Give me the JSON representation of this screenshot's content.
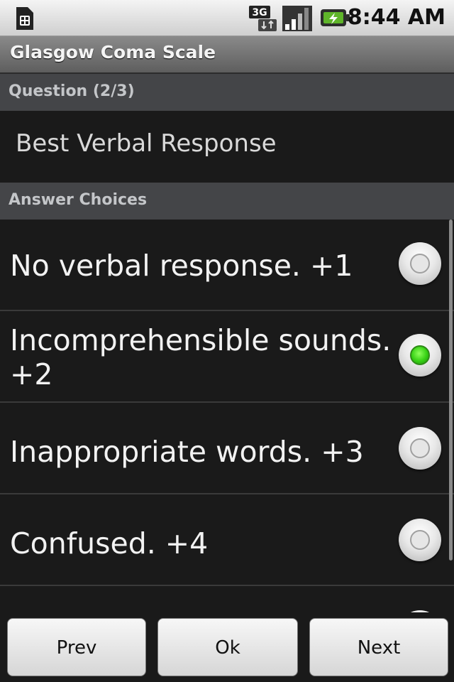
{
  "status_bar": {
    "time": "8:44 AM",
    "network_type": "3G",
    "icons": [
      "sim-card-icon",
      "network-3g-icon",
      "signal-strength-icon",
      "battery-charging-icon"
    ]
  },
  "title": "Glasgow Coma Scale",
  "question_header": "Question (2/3)",
  "question_text": "Best Verbal Response",
  "answers_header": "Answer Choices",
  "answers": [
    {
      "label": "No verbal response. +1",
      "selected": false
    },
    {
      "label": "Incomprehensible sounds. +2",
      "selected": true
    },
    {
      "label": "Inappropriate words. +3",
      "selected": false
    },
    {
      "label": "Confused. +4",
      "selected": false
    }
  ],
  "buttons": {
    "prev": "Prev",
    "ok": "Ok",
    "next": "Next"
  },
  "colors": {
    "selected_radio": "#36d014",
    "background": "#1a1a1a",
    "section_header": "#444548"
  }
}
